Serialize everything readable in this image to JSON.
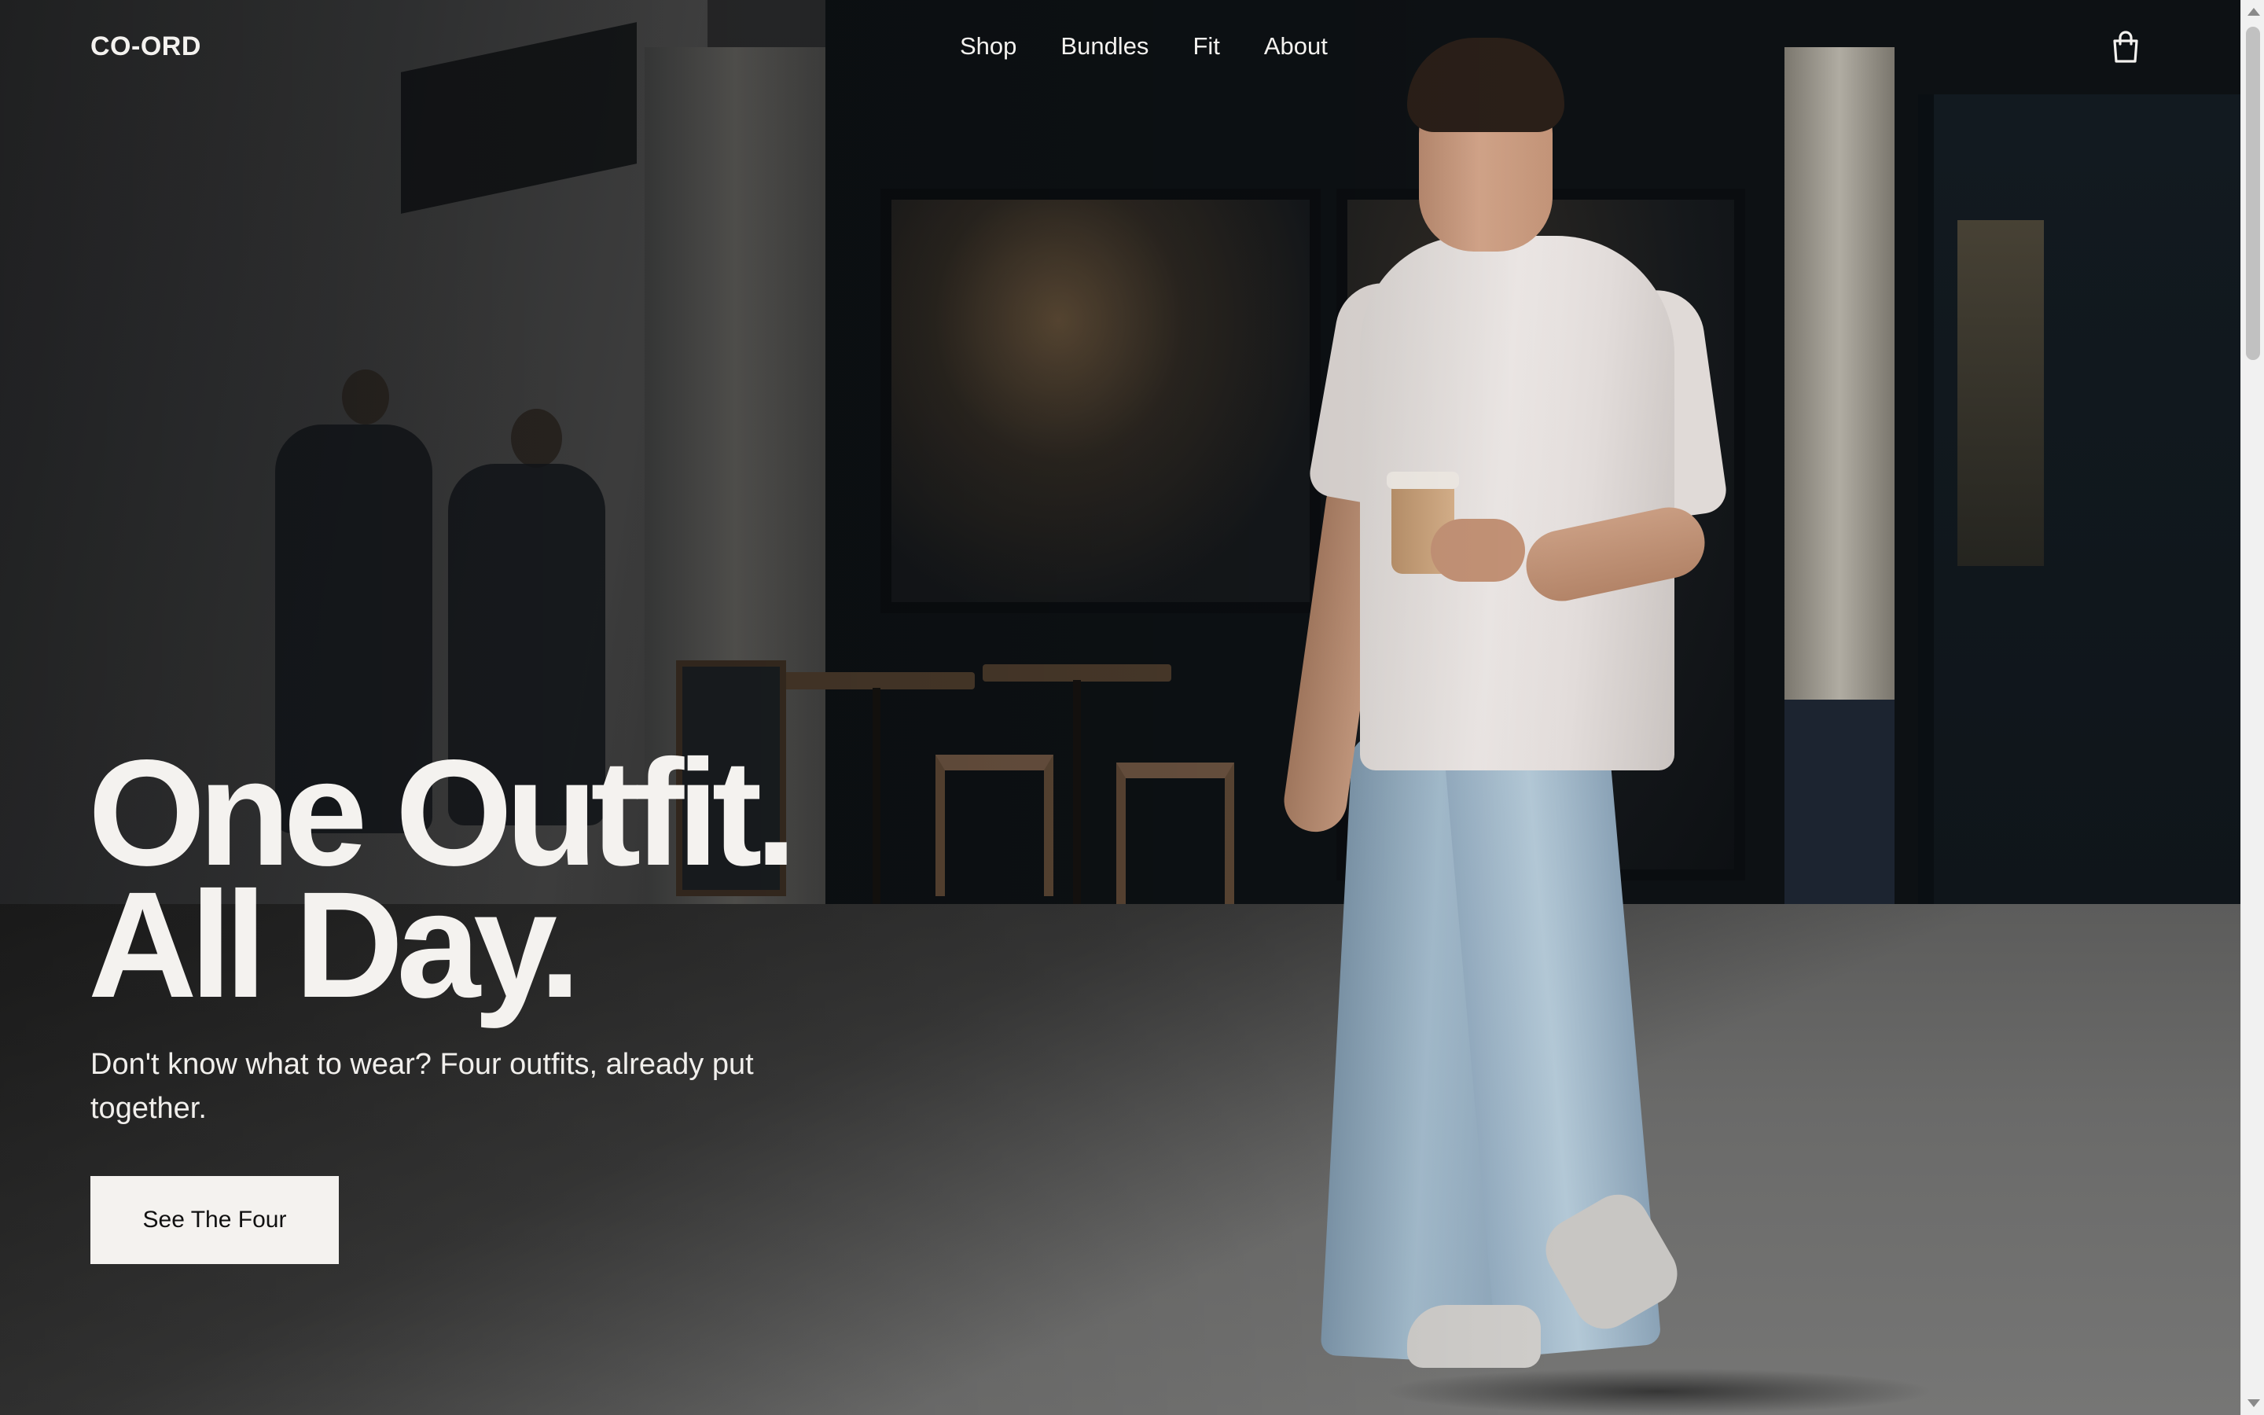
{
  "header": {
    "logo": "CO-ORD",
    "nav": [
      "Shop",
      "Bundles",
      "Fit",
      "About"
    ],
    "cart_icon": "shopping-bag-icon"
  },
  "hero": {
    "headline_line1": "One Outfit.",
    "headline_line2": "All Day.",
    "subhead": "Don't know what to wear? Four outfits, already put together.",
    "cta_label": "See The Four"
  },
  "colors": {
    "text_light": "#f4f2ef",
    "button_bg": "#f4f2ef",
    "button_text": "#111111"
  }
}
